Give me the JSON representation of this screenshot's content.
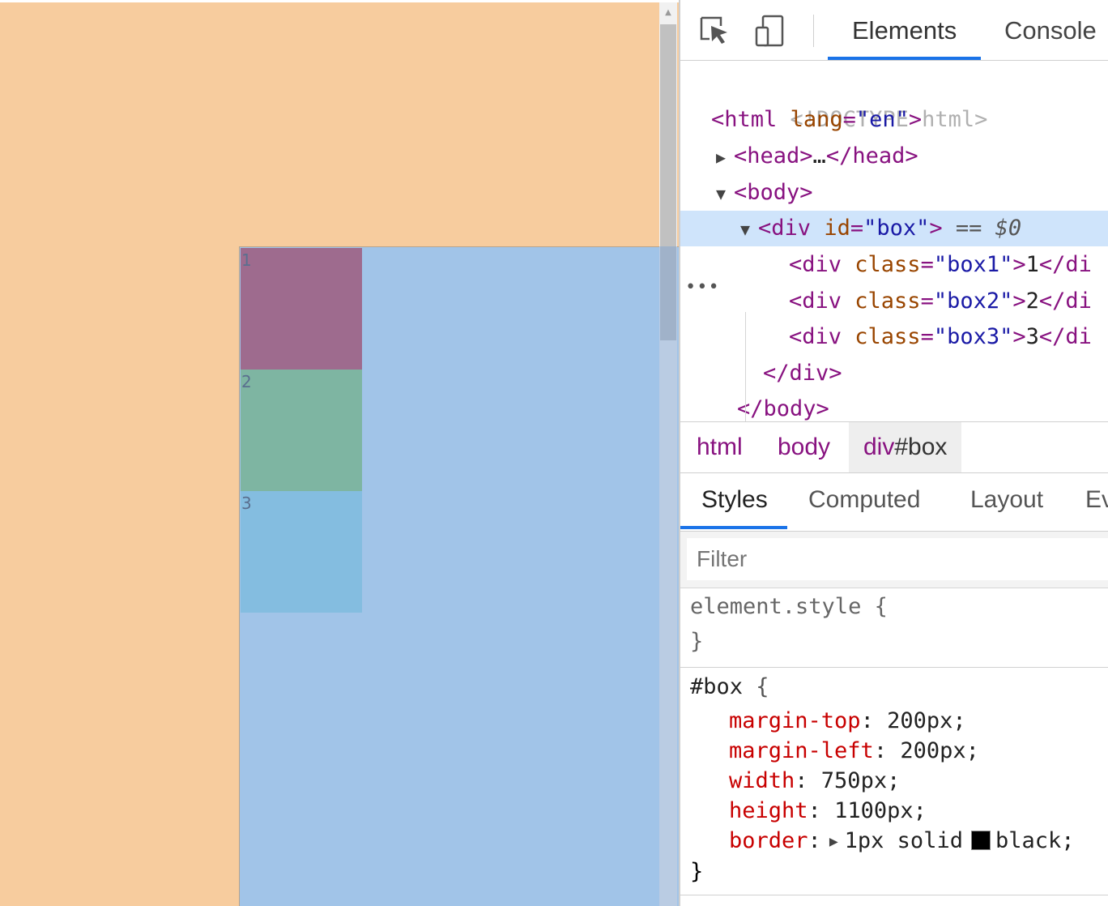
{
  "page": {
    "children": [
      {
        "label": "1"
      },
      {
        "label": "2"
      },
      {
        "label": "3"
      }
    ]
  },
  "devtools": {
    "tabs": {
      "elements": "Elements",
      "console": "Console"
    },
    "dom_tree": {
      "doctype": "<!DOCTYPE html>",
      "html_tag": "html",
      "html_attr": "lang",
      "html_attr_val": "\"en\"",
      "head_open": "<head>",
      "head_ellipsis": "…",
      "head_close": "</head>",
      "body_open": "<body>",
      "div_tag": "div",
      "div_attr": "id",
      "div_attr_val": "\"box\"",
      "selected_marker": "== $0",
      "children": [
        {
          "attr": "class",
          "val": "\"box1\"",
          "text": "1",
          "close": "</di"
        },
        {
          "attr": "class",
          "val": "\"box2\"",
          "text": "2",
          "close": "</di"
        },
        {
          "attr": "class",
          "val": "\"box3\"",
          "text": "3",
          "close": "</di"
        }
      ],
      "div_close": "</div>",
      "body_close": "</body>"
    },
    "breadcrumbs": {
      "html": "html",
      "body": "body",
      "div_tag": "div",
      "div_id": "#box"
    },
    "panel_tabs": {
      "styles": "Styles",
      "computed": "Computed",
      "layout": "Layout",
      "ev": "Ev"
    },
    "filter": {
      "placeholder": "Filter"
    },
    "styles": {
      "element_style_selector": "element.style {",
      "element_style_close": "}",
      "box_selector": "#box",
      "box_open": "{",
      "box_close": "}",
      "properties": [
        {
          "name": "margin-top",
          "value": "200px;"
        },
        {
          "name": "margin-left",
          "value": "200px;"
        },
        {
          "name": "width",
          "value": "750px;"
        },
        {
          "name": "height",
          "value": "1100px;"
        },
        {
          "name": "border",
          "value": "1px solid",
          "color_name": "black;",
          "swatch": "#000000"
        }
      ]
    }
  },
  "colors": {
    "page_bg": "#f7cc9e",
    "box_highlight": "#a1c4e8",
    "box1": "#9e6b8e",
    "box2": "#7eb5a2",
    "box3": "#84bde0",
    "accent": "#1a73e8",
    "selected_row": "#cfe4fb"
  },
  "icons": [
    "inspect-element-icon",
    "device-toolbar-icon",
    "expand-arrow-icon",
    "collapse-arrow-icon",
    "more-dots-icon",
    "scroll-up-arrow-icon"
  ]
}
